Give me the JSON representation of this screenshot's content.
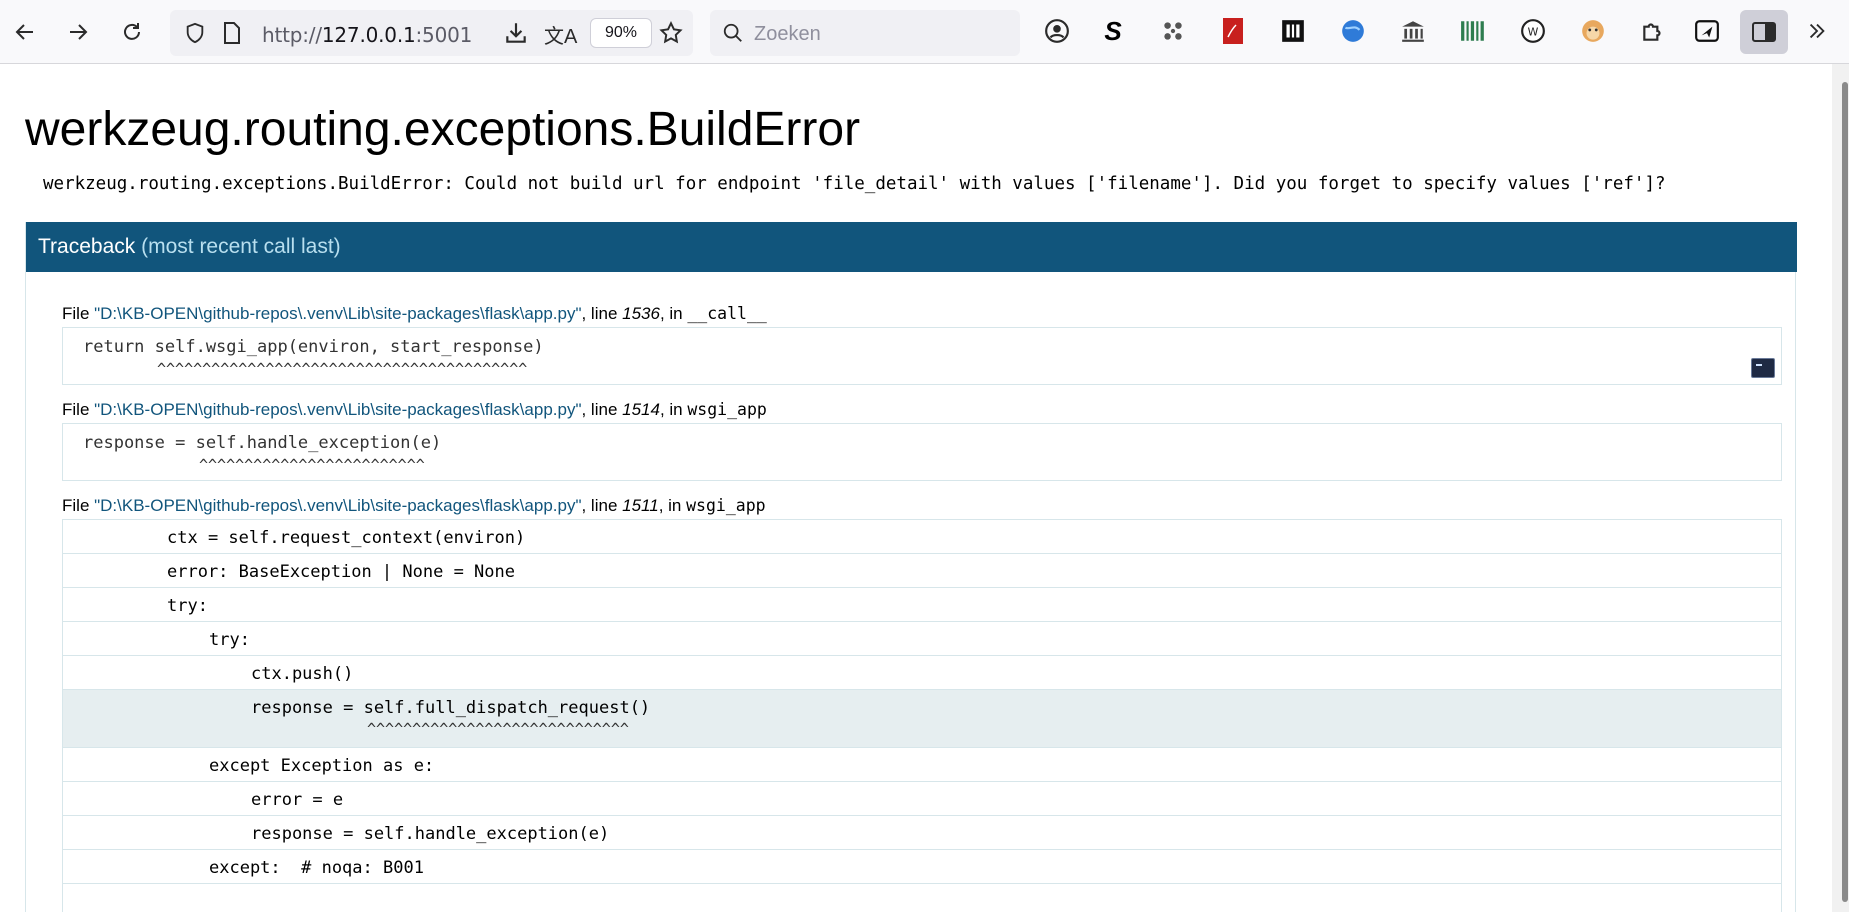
{
  "browser": {
    "url_prefix": "http://",
    "url_host": "127.0.0.1",
    "url_port": ":5001",
    "zoom": "90%",
    "search_placeholder": "Zoeken"
  },
  "error": {
    "title": "werkzeug.routing.exceptions.BuildError",
    "message": "werkzeug.routing.exceptions.BuildError: Could not build url for endpoint 'file_detail' with values ['filename']. Did you forget to specify values ['ref']?"
  },
  "traceback": {
    "header": "Traceback",
    "header_sub": "(most recent call last)",
    "frames": [
      {
        "file": "\"D:\\KB-OPEN\\github-repos\\.venv\\Lib\\site-packages\\flask\\app.py\"",
        "line": "1536",
        "func": "__call__",
        "code": "return self.wsgi_app(environ, start_response)",
        "carets": "^^^^^^^^^^^^^^^^^^^^^^^^^^^^^^^^^^^^^^^^^"
      },
      {
        "file": "\"D:\\KB-OPEN\\github-repos\\.venv\\Lib\\site-packages\\flask\\app.py\"",
        "line": "1514",
        "func": "wsgi_app",
        "code": "response = self.handle_exception(e)",
        "carets": "^^^^^^^^^^^^^^^^^^^^^^^^^"
      },
      {
        "file": "\"D:\\KB-OPEN\\github-repos\\.venv\\Lib\\site-packages\\flask\\app.py\"",
        "line": "1511",
        "func": "wsgi_app",
        "lines": [
          "ctx = self.request_context(environ)",
          "error: BaseException | None = None",
          "try:",
          "try:",
          "ctx.push()",
          "response = self.full_dispatch_request()",
          "except Exception as e:",
          "error = e",
          "response = self.handle_exception(e)",
          "except:  # noqa: B001"
        ],
        "highlight_carets": "^^^^^^^^^^^^^^^^^^^^^^^^^^^^^"
      }
    ],
    "labels": {
      "file": "File ",
      "line": ", line ",
      "in": ", in "
    }
  }
}
